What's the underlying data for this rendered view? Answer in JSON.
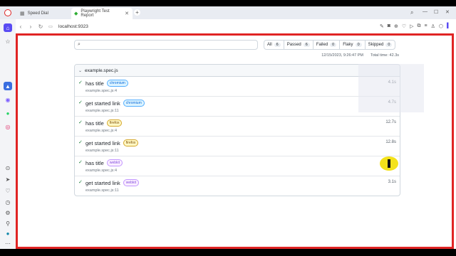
{
  "tabs": [
    {
      "title": "Speed Dial",
      "icon": "speed-dial-icon"
    },
    {
      "title": "Playwright Test Report",
      "icon": "playwright-icon",
      "active": true
    }
  ],
  "address": {
    "url": "localhost:9323"
  },
  "search": {
    "placeholder": ""
  },
  "filters": [
    {
      "label": "All",
      "count": "6"
    },
    {
      "label": "Passed",
      "count": "6"
    },
    {
      "label": "Failed",
      "count": "0"
    },
    {
      "label": "Flaky",
      "count": "0"
    },
    {
      "label": "Skipped",
      "count": "0"
    }
  ],
  "meta": {
    "date": "12/15/2023, 9:26:47 PM",
    "total": "Total time: 42.3s"
  },
  "suite": {
    "name": "example.spec.js",
    "tests": [
      {
        "title": "has title",
        "project": "chromium",
        "location": "example.spec.js:4",
        "duration": "4.1s"
      },
      {
        "title": "get started link",
        "project": "chromium",
        "location": "example.spec.js:11",
        "duration": "4.7s"
      },
      {
        "title": "has title",
        "project": "firefox",
        "location": "example.spec.js:4",
        "duration": "12.7s"
      },
      {
        "title": "get started link",
        "project": "firefox",
        "location": "example.spec.js:11",
        "duration": "12.8s"
      },
      {
        "title": "has title",
        "project": "webkit",
        "location": "example.spec.js:4",
        "duration": "5.5s"
      },
      {
        "title": "get started link",
        "project": "webkit",
        "location": "example.spec.js:11",
        "duration": "3.1s"
      }
    ]
  }
}
